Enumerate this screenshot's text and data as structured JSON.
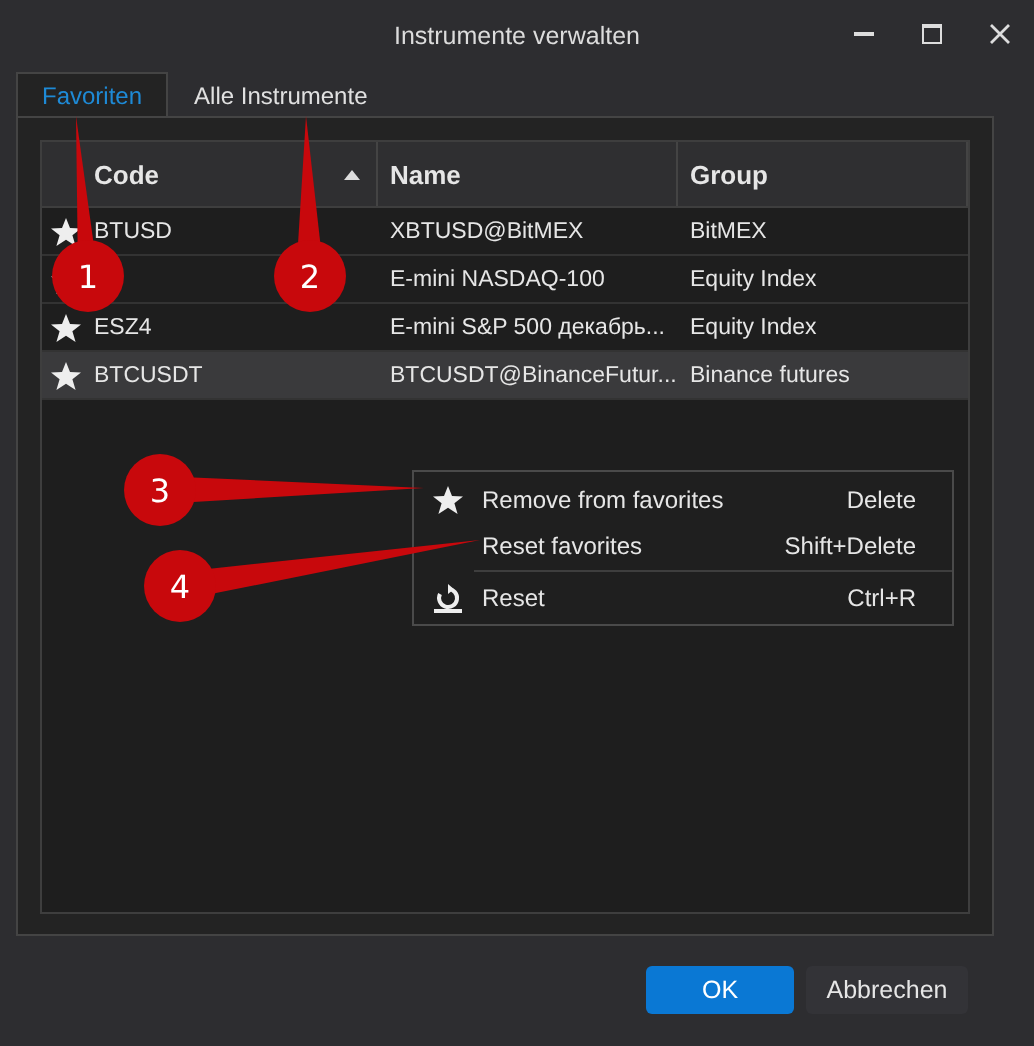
{
  "window": {
    "title": "Instrumente verwalten"
  },
  "tabs": [
    {
      "label": "Favoriten",
      "selected": true
    },
    {
      "label": "Alle Instrumente",
      "selected": false
    }
  ],
  "table": {
    "columns": [
      {
        "label": "Code",
        "sorted": true
      },
      {
        "label": "Name"
      },
      {
        "label": "Group"
      }
    ],
    "rows": [
      {
        "favorite": true,
        "code": "BTUSD",
        "name": "XBTUSD@BitMEX",
        "group": "BitMEX",
        "selected": false
      },
      {
        "favorite": true,
        "name": "E-mini NASDAQ-100",
        "group": "Equity Index",
        "selected": false
      },
      {
        "favorite": true,
        "code": "ESZ4",
        "name": "E-mini S&P 500 декабрь...",
        "group": "Equity Index",
        "selected": false
      },
      {
        "favorite": true,
        "code": "BTCUSDT",
        "name": "BTCUSDT@BinanceFutur...",
        "group": "Binance futures",
        "selected": true
      }
    ]
  },
  "context_menu": {
    "items": [
      {
        "kind": "unfavorite",
        "label": "Remove from favorites",
        "shortcut": "Delete",
        "separator_before": false
      },
      {
        "kind": "plain",
        "label": "Reset favorites",
        "shortcut": "Shift+Delete",
        "separator_before": false
      },
      {
        "kind": "reset",
        "label": "Reset",
        "shortcut": "Ctrl+R",
        "separator_before": true
      }
    ]
  },
  "buttons": [
    {
      "label": "OK",
      "kind": "primary"
    },
    {
      "label": "Abbrechen",
      "kind": "secondary"
    }
  ],
  "callouts": [
    {
      "number": "1"
    },
    {
      "number": "2"
    },
    {
      "number": "3"
    },
    {
      "number": "4"
    }
  ]
}
